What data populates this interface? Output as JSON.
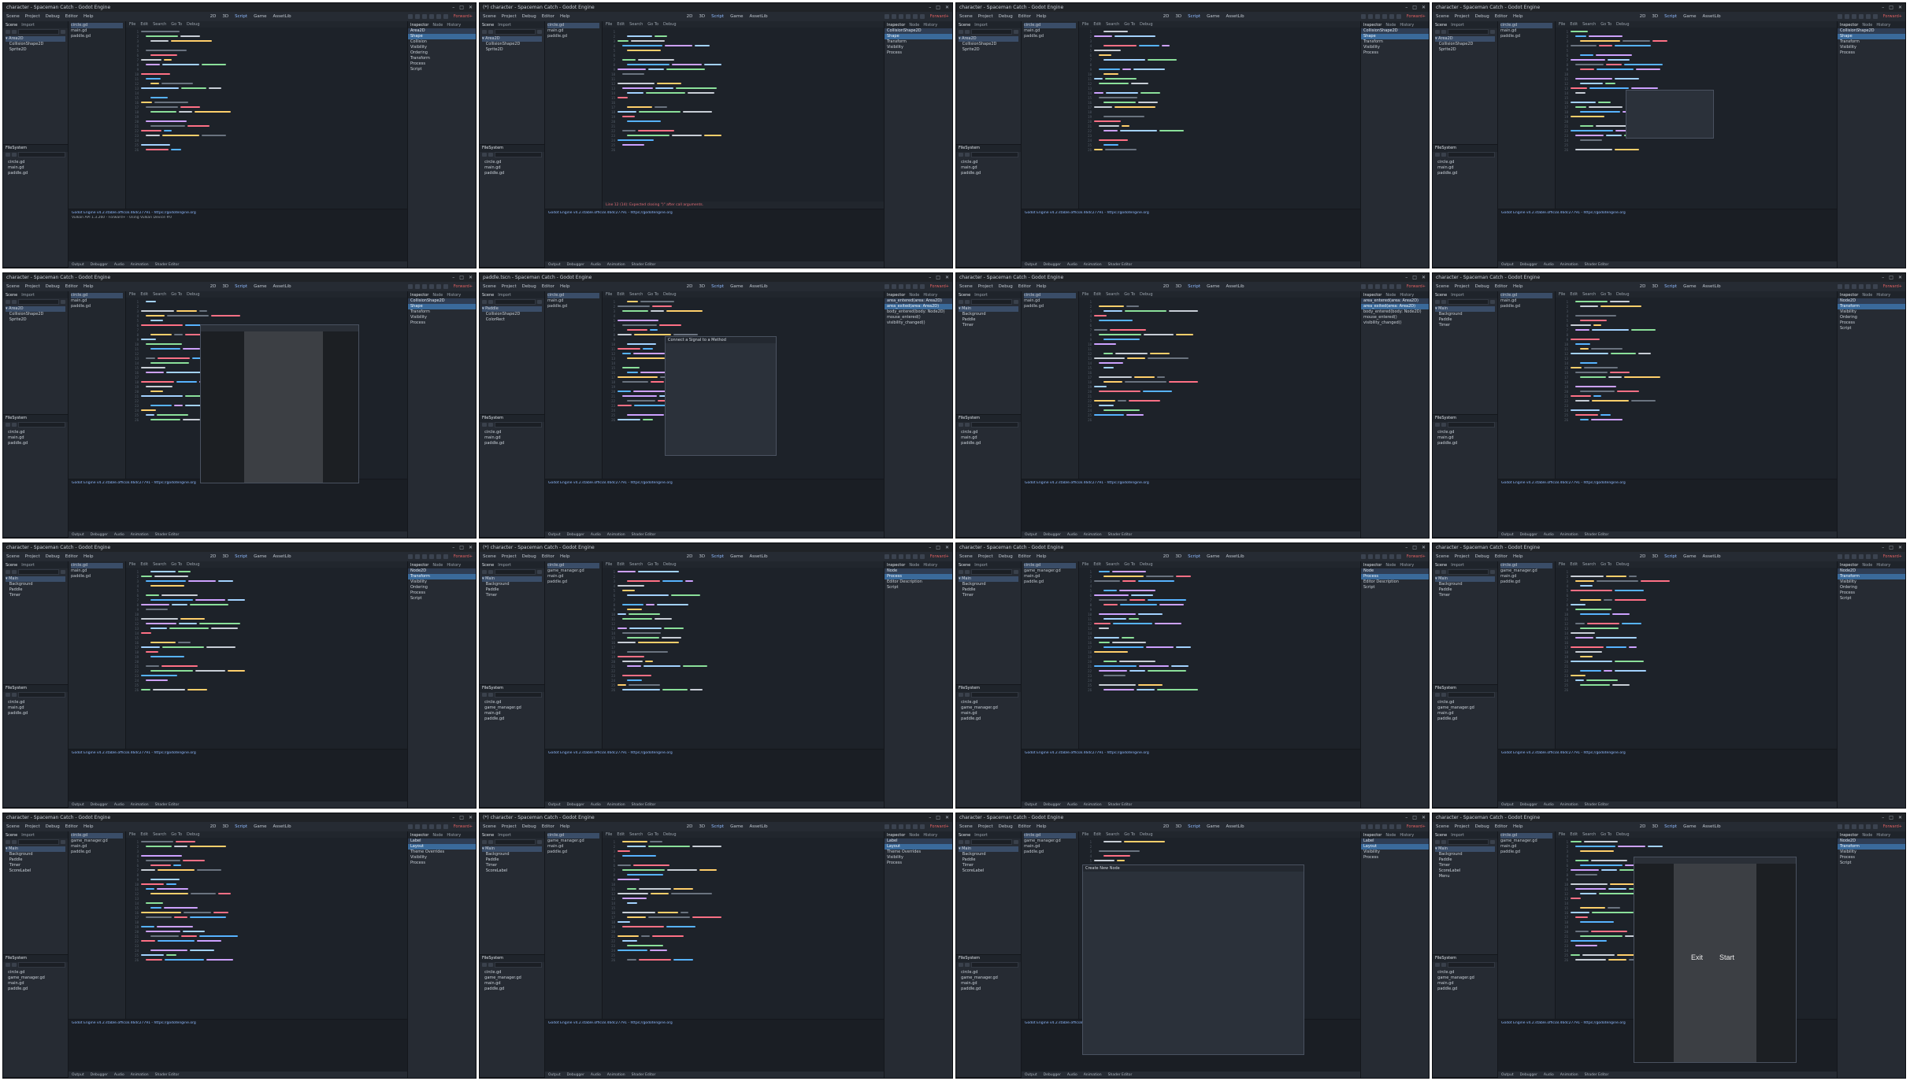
{
  "menus": [
    "Scene",
    "Project",
    "Debug",
    "Editor",
    "Help"
  ],
  "workspaces": [
    "2D",
    "3D",
    "Script",
    "Game",
    "AssetLib"
  ],
  "renderer_label": "Forward+",
  "dock_tabs": {
    "scene": [
      "Scene",
      "Import"
    ],
    "filesystem": [
      "FileSystem"
    ],
    "inspector": [
      "Inspector",
      "Node",
      "History"
    ]
  },
  "panels": [
    {
      "title": "character - Spaceman Catch - Godot Engine",
      "scene_tree": [
        "Area2D",
        "CollisionShape2D",
        "Sprite2D"
      ],
      "scripts": [
        "circle.gd",
        "main.gd",
        "paddle.gd"
      ],
      "inspector": [
        "Area2D",
        "Shape",
        "Collision",
        "Visibility",
        "Ordering",
        "Transform",
        "Process",
        "Script"
      ],
      "output": [
        "Godot Engine v4.2.stable.official.46dc27791 - https://godotengine.org",
        "Vulkan API 1.3.260 - Forward+ - Using Vulkan Device #0"
      ],
      "status": "",
      "overlay": "none"
    },
    {
      "title": "(*) character - Spaceman Catch - Godot Engine",
      "scene_tree": [
        "Area2D",
        "CollisionShape2D",
        "Sprite2D"
      ],
      "scripts": [
        "circle.gd",
        "main.gd",
        "paddle.gd"
      ],
      "inspector": [
        "CollisionShape2D",
        "Shape",
        "Transform",
        "Visibility",
        "Process"
      ],
      "output": [
        "Godot Engine v4.2.stable.official.46dc27791 - https://godotengine.org"
      ],
      "status": "Line 12 (14): Expected closing \")\" after call arguments.",
      "overlay": "none"
    },
    {
      "title": "character - Spaceman Catch - Godot Engine",
      "scene_tree": [
        "Area2D",
        "CollisionShape2D",
        "Sprite2D"
      ],
      "scripts": [
        "circle.gd",
        "main.gd",
        "paddle.gd"
      ],
      "inspector": [
        "CollisionShape2D",
        "Shape",
        "Transform",
        "Visibility",
        "Process"
      ],
      "output": [
        "Godot Engine v4.2.stable.official.46dc27791 - https://godotengine.org"
      ],
      "status": "",
      "overlay": "none"
    },
    {
      "title": "character - Spaceman Catch - Godot Engine",
      "scene_tree": [
        "Area2D",
        "CollisionShape2D",
        "Sprite2D"
      ],
      "scripts": [
        "circle.gd",
        "main.gd",
        "paddle.gd"
      ],
      "inspector": [
        "CollisionShape2D",
        "Shape",
        "Transform",
        "Visibility",
        "Process"
      ],
      "output": [
        "Godot Engine v4.2.stable.official.46dc27791 - https://godotengine.org"
      ],
      "status": "",
      "overlay": "autocomplete"
    },
    {
      "title": "character - Spaceman Catch - Godot Engine",
      "scene_tree": [
        "Area2D",
        "CollisionShape2D",
        "Sprite2D"
      ],
      "scripts": [
        "circle.gd",
        "main.gd",
        "paddle.gd"
      ],
      "inspector": [
        "CollisionShape2D",
        "Shape",
        "Transform",
        "Visibility",
        "Process"
      ],
      "output": [
        "Godot Engine v4.2.stable.official.46dc27791 - https://godotengine.org"
      ],
      "status": "",
      "overlay": "game-window"
    },
    {
      "title": "paddle.tscn - Spaceman Catch - Godot Engine",
      "scene_tree": [
        "Paddle",
        "CollisionShape2D",
        "ColorRect"
      ],
      "scripts": [
        "circle.gd",
        "main.gd",
        "paddle.gd"
      ],
      "inspector": [
        "area_entered(area: Area2D)",
        "area_exited(area: Area2D)",
        "body_entered(body: Node2D)",
        "mouse_entered()",
        "visibility_changed()"
      ],
      "output": [
        "Godot Engine v4.2.stable.official.46dc27791 - https://godotengine.org"
      ],
      "status": "",
      "overlay": "connect-signal"
    },
    {
      "title": "character - Spaceman Catch - Godot Engine",
      "scene_tree": [
        "Main",
        "Background",
        "Paddle",
        "Timer"
      ],
      "scripts": [
        "circle.gd",
        "main.gd",
        "paddle.gd"
      ],
      "inspector": [
        "area_entered(area: Area2D)",
        "area_exited(area: Area2D)",
        "body_entered(body: Node2D)",
        "mouse_entered()",
        "visibility_changed()"
      ],
      "output": [
        "Godot Engine v4.2.stable.official.46dc27791 - https://godotengine.org"
      ],
      "status": "",
      "overlay": "none"
    },
    {
      "title": "character - Spaceman Catch - Godot Engine",
      "scene_tree": [
        "Main",
        "Background",
        "Paddle",
        "Timer"
      ],
      "scripts": [
        "circle.gd",
        "main.gd",
        "paddle.gd"
      ],
      "inspector": [
        "Node2D",
        "Transform",
        "Visibility",
        "Ordering",
        "Process",
        "Script"
      ],
      "output": [
        "Godot Engine v4.2.stable.official.46dc27791 - https://godotengine.org"
      ],
      "status": "",
      "overlay": "none"
    },
    {
      "title": "character - Spaceman Catch - Godot Engine",
      "scene_tree": [
        "Main",
        "Background",
        "Paddle",
        "Timer"
      ],
      "scripts": [
        "circle.gd",
        "main.gd",
        "paddle.gd"
      ],
      "inspector": [
        "Node2D",
        "Transform",
        "Visibility",
        "Ordering",
        "Process",
        "Script"
      ],
      "output": [
        "Godot Engine v4.2.stable.official.46dc27791 - https://godotengine.org"
      ],
      "status": "",
      "overlay": "none"
    },
    {
      "title": "(*) character - Spaceman Catch - Godot Engine",
      "scene_tree": [
        "Main",
        "Background",
        "Paddle",
        "Timer"
      ],
      "scripts": [
        "circle.gd",
        "game_manager.gd",
        "main.gd",
        "paddle.gd"
      ],
      "inspector": [
        "Node",
        "Process",
        "Editor Description",
        "Script"
      ],
      "output": [
        "Godot Engine v4.2.stable.official.46dc27791 - https://godotengine.org"
      ],
      "status": "",
      "overlay": "none"
    },
    {
      "title": "character - Spaceman Catch - Godot Engine",
      "scene_tree": [
        "Main",
        "Background",
        "Paddle",
        "Timer"
      ],
      "scripts": [
        "circle.gd",
        "game_manager.gd",
        "main.gd",
        "paddle.gd"
      ],
      "inspector": [
        "Node",
        "Process",
        "Editor Description",
        "Script"
      ],
      "output": [
        "Godot Engine v4.2.stable.official.46dc27791 - https://godotengine.org"
      ],
      "status": "",
      "overlay": "none"
    },
    {
      "title": "character - Spaceman Catch - Godot Engine",
      "scene_tree": [
        "Main",
        "Background",
        "Paddle",
        "Timer"
      ],
      "scripts": [
        "circle.gd",
        "game_manager.gd",
        "main.gd",
        "paddle.gd"
      ],
      "inspector": [
        "Node2D",
        "Transform",
        "Visibility",
        "Ordering",
        "Process",
        "Script"
      ],
      "output": [
        "Godot Engine v4.2.stable.official.46dc27791 - https://godotengine.org"
      ],
      "status": "",
      "overlay": "none"
    },
    {
      "title": "character - Spaceman Catch - Godot Engine",
      "scene_tree": [
        "Main",
        "Background",
        "Paddle",
        "Timer",
        "ScoreLabel"
      ],
      "scripts": [
        "circle.gd",
        "game_manager.gd",
        "main.gd",
        "paddle.gd"
      ],
      "inspector": [
        "Label",
        "Layout",
        "Theme Overrides",
        "Visibility",
        "Process"
      ],
      "output": [
        "Godot Engine v4.2.stable.official.46dc27791 - https://godotengine.org"
      ],
      "status": "",
      "overlay": "none"
    },
    {
      "title": "(*) character - Spaceman Catch - Godot Engine",
      "scene_tree": [
        "Main",
        "Background",
        "Paddle",
        "Timer",
        "ScoreLabel"
      ],
      "scripts": [
        "circle.gd",
        "game_manager.gd",
        "main.gd",
        "paddle.gd"
      ],
      "inspector": [
        "Label",
        "Layout",
        "Theme Overrides",
        "Visibility",
        "Process"
      ],
      "output": [
        "Godot Engine v4.2.stable.official.46dc27791 - https://godotengine.org"
      ],
      "status": "",
      "overlay": "none"
    },
    {
      "title": "character - Spaceman Catch - Godot Engine",
      "scene_tree": [
        "Main",
        "Background",
        "Paddle",
        "Timer",
        "ScoreLabel"
      ],
      "scripts": [
        "circle.gd",
        "game_manager.gd",
        "main.gd",
        "paddle.gd"
      ],
      "inspector": [
        "Label",
        "Layout",
        "Visibility",
        "Process"
      ],
      "output": [
        "Godot Engine v4.2.stable.official.46dc27791 - https://godotengine.org"
      ],
      "status": "",
      "overlay": "create-node"
    },
    {
      "title": "character - Spaceman Catch - Godot Engine",
      "scene_tree": [
        "Main",
        "Background",
        "Paddle",
        "Timer",
        "ScoreLabel",
        "Menu"
      ],
      "scripts": [
        "circle.gd",
        "game_manager.gd",
        "main.gd",
        "paddle.gd"
      ],
      "inspector": [
        "Node2D",
        "Transform",
        "Visibility",
        "Process",
        "Script"
      ],
      "output": [
        "Godot Engine v4.2.stable.official.46dc27791 - https://godotengine.org"
      ],
      "status": "",
      "overlay": "game-menu",
      "game_menu": {
        "exit": "Exit",
        "start": "Start"
      }
    }
  ]
}
